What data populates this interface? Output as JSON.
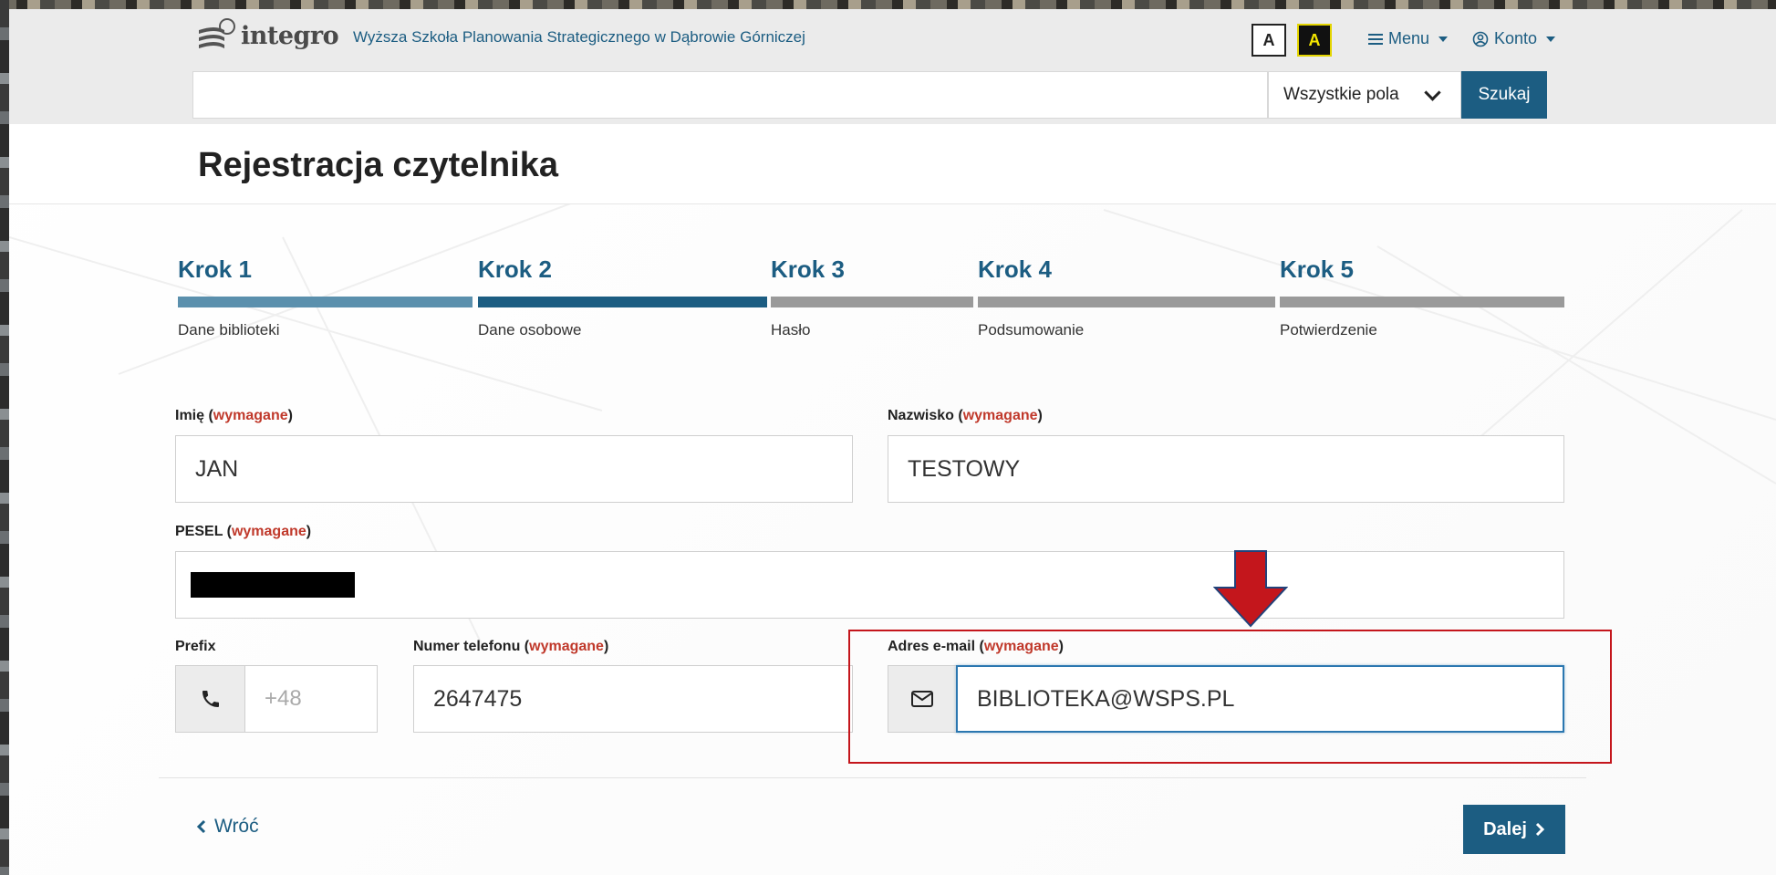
{
  "header": {
    "logo_text": "integro",
    "institution": "Wyższa Szkoła Planowania Strategicznego w Dąbrowie Górniczej",
    "contrast_normal": "A",
    "contrast_high": "A",
    "menu_label": "Menu",
    "account_label": "Konto"
  },
  "search": {
    "query": "",
    "scope": "Wszystkie pola",
    "button": "Szukaj"
  },
  "page_title": "Rejestracja czytelnika",
  "steps": [
    {
      "label": "Krok 1",
      "desc": "Dane biblioteki",
      "state": "done"
    },
    {
      "label": "Krok 2",
      "desc": "Dane osobowe",
      "state": "current"
    },
    {
      "label": "Krok 3",
      "desc": "Hasło",
      "state": "todo"
    },
    {
      "label": "Krok 4",
      "desc": "Podsumowanie",
      "state": "todo"
    },
    {
      "label": "Krok 5",
      "desc": "Potwierdzenie",
      "state": "todo"
    }
  ],
  "form": {
    "required_word": "wymagane",
    "first_name": {
      "label": "Imię",
      "value": "JAN"
    },
    "last_name": {
      "label": "Nazwisko",
      "value": "TESTOWY"
    },
    "pesel": {
      "label": "PESEL",
      "value": ""
    },
    "prefix": {
      "label": "Prefix",
      "placeholder": "+48"
    },
    "phone": {
      "label": "Numer telefonu",
      "value": "2647475"
    },
    "email": {
      "label": "Adres e-mail",
      "value": "BIBLIOTEKA@WSPS.PL"
    }
  },
  "nav": {
    "back": "Wróć",
    "next": "Dalej"
  },
  "colors": {
    "primary": "#1c5d82",
    "step_done": "#5b90ad",
    "step_todo": "#9a9a9a",
    "required": "#c0392b",
    "annotation": "#c4161c"
  }
}
